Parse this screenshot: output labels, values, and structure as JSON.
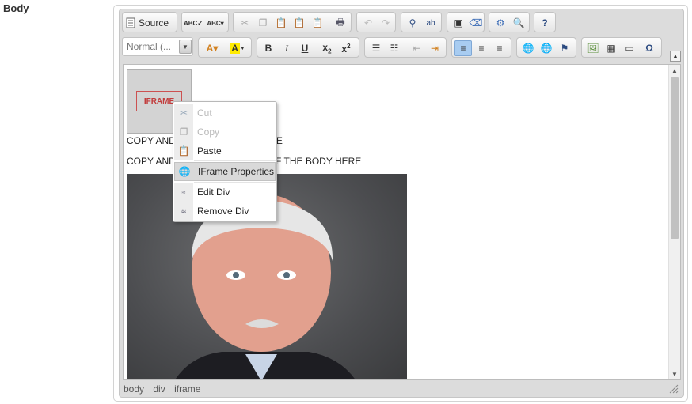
{
  "field_label": "Body",
  "toolbar": {
    "source_label": "Source",
    "format_value": "Normal (..."
  },
  "content": {
    "iframe_placeholder_label": "IFRAME",
    "para1": "COPY AND PASTE CAPTION HERE",
    "para2": "COPY AND PASTE FIRST HALF OF THE BODY HERE"
  },
  "context_menu": {
    "cut": "Cut",
    "copy": "Copy",
    "paste": "Paste",
    "iframe_properties": "IFrame Properties",
    "edit_div": "Edit Div",
    "remove_div": "Remove Div"
  },
  "pathbar": [
    "body",
    "div",
    "iframe"
  ]
}
